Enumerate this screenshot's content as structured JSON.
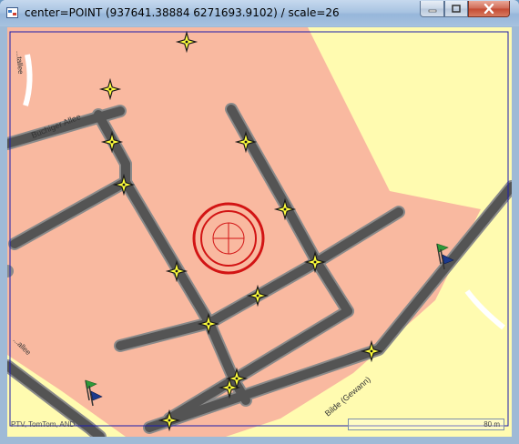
{
  "window": {
    "title": "center=POINT (937641.38884 6271693.9102) / scale=26",
    "controls": {
      "minimize": "minimize",
      "maximize": "maximize",
      "close": "close"
    }
  },
  "map": {
    "street_labels": [
      "Buchiger Allee",
      "Bilde (Gewann)",
      "...tallee",
      "...allee"
    ],
    "attribution": "PTV, TomTom, AND",
    "scale_label": "80 m"
  },
  "colors": {
    "land": "#fffbb0",
    "area": "#f9b9a0",
    "road": "#545454",
    "road_border": "#8a8a8a",
    "marker": "#ffff3c",
    "center_ring": "#d21414",
    "frame": "#1c1cac",
    "flag_green": "#2f9a3a",
    "flag_blue": "#1c3a8c"
  }
}
